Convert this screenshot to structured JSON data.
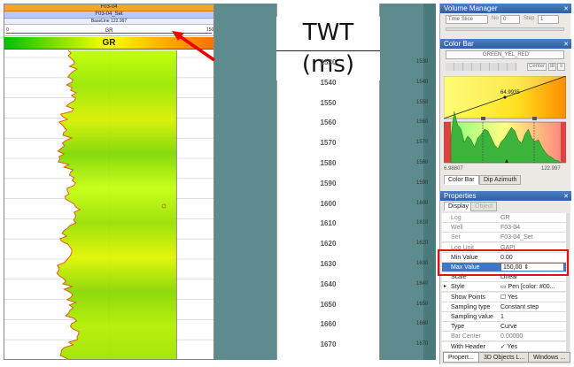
{
  "log_track": {
    "well_name": "F03-04",
    "set_name": "F03-04_Set",
    "baseline_label": "BaseLine 122.997",
    "baseline_min": "0",
    "baseline_max": "150",
    "gr_small_label": "GR",
    "gr_min": "0",
    "gr_max": "150",
    "gr_bar_label": "GR"
  },
  "depth_view": {
    "title": "TWT (ms)",
    "labels": [
      "1530",
      "1540",
      "1550",
      "1560",
      "1570",
      "1580",
      "1590",
      "1600",
      "1610",
      "1620",
      "1630",
      "1640",
      "1650",
      "1660",
      "1670"
    ],
    "right_labels": [
      "1530",
      "1540",
      "1550",
      "1560",
      "1570",
      "1580",
      "1590",
      "1600",
      "1610",
      "1620",
      "1630",
      "1640",
      "1650",
      "1660",
      "1670"
    ]
  },
  "volume_manager": {
    "title": "Volume Manager",
    "time_slice": "Time Slice",
    "no_label": "No",
    "no_value": "0",
    "step_label": "Step",
    "step_value": "1"
  },
  "color_bar": {
    "title": "Color Bar",
    "colormap": "GREEN_YEL_RED",
    "center_label": "Center",
    "mid_value": "64.9935",
    "min_value": "6.98807",
    "max_value": "122.997",
    "tabs": [
      "Color Bar",
      "Dip Azimuth"
    ]
  },
  "properties": {
    "title": "Properties",
    "tabs": [
      "Display",
      "Object"
    ],
    "rows": [
      {
        "key": "Log",
        "value": "GR",
        "enabled": false
      },
      {
        "key": "Well",
        "value": "F03-04",
        "enabled": false
      },
      {
        "key": "Set",
        "value": "F03-04_Set",
        "enabled": false
      },
      {
        "key": "Log Unit",
        "value": "GAPI",
        "enabled": false
      },
      {
        "key": "Min Value",
        "value": "0.00",
        "enabled": true
      },
      {
        "key": "Max Value",
        "value": "150,00",
        "enabled": true
      },
      {
        "key": "Scale",
        "value": "Linear",
        "enabled": true
      },
      {
        "key": "Style",
        "value": "Pen [color: #00...",
        "enabled": true
      },
      {
        "key": "Show Points",
        "value": "Yes",
        "enabled": true
      },
      {
        "key": "Sampling type",
        "value": "Constant step",
        "enabled": true
      },
      {
        "key": "Sampling value",
        "value": "1",
        "enabled": true
      },
      {
        "key": "Type",
        "value": "Curve",
        "enabled": true
      },
      {
        "key": "Bar Center",
        "value": "0.00000",
        "enabled": false
      },
      {
        "key": "With Header",
        "value": "Yes",
        "enabled": true
      }
    ]
  },
  "bottom_tabs": [
    "Propert...",
    "3D Objects L...",
    "Windows ..."
  ],
  "colors": {
    "teal": "#5e8c8e",
    "title_blue": "#2f5fa5",
    "highlight_red": "#e61010",
    "selection_blue": "#3b78c8"
  }
}
